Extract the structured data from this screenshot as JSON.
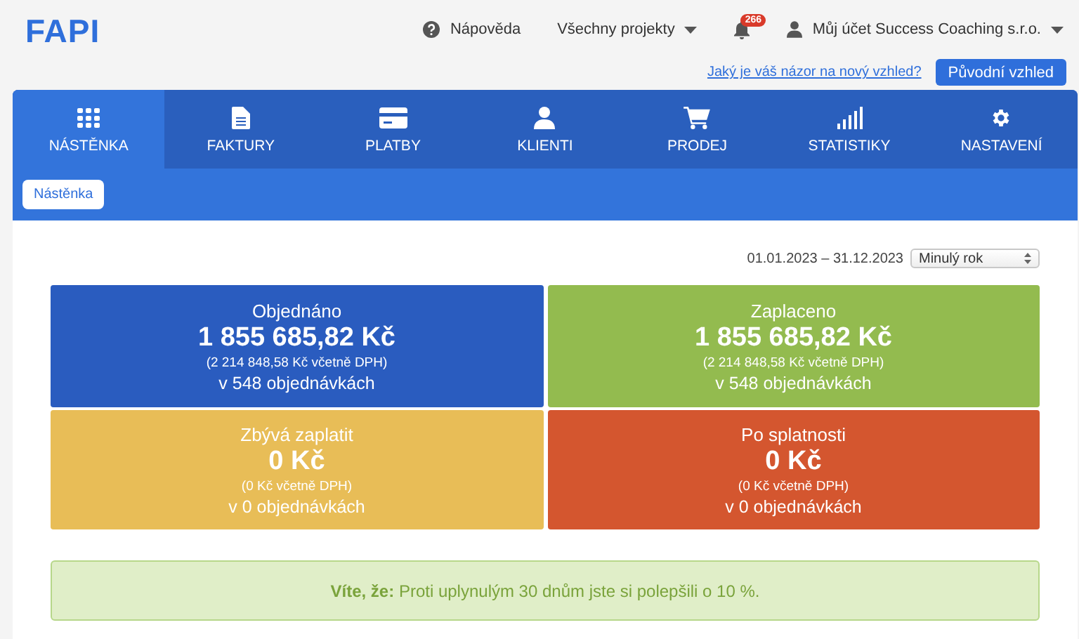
{
  "logo": "FAPI",
  "header": {
    "help": "Nápověda",
    "projects": "Všechny projekty",
    "notifications": "266",
    "account": "Můj účet Success Coaching s.r.o.",
    "feedback_link": "Jaký je váš názor na nový vzhled?",
    "old_look_button": "Původní vzhled"
  },
  "tabs": [
    {
      "label": "NÁSTĚNKA",
      "selected": true
    },
    {
      "label": "FAKTURY",
      "selected": false
    },
    {
      "label": "PLATBY",
      "selected": false
    },
    {
      "label": "KLIENTI",
      "selected": false
    },
    {
      "label": "PRODEJ",
      "selected": false
    },
    {
      "label": "STATISTIKY",
      "selected": false
    },
    {
      "label": "NASTAVENÍ",
      "selected": false
    }
  ],
  "breadcrumb": "Nástěnka",
  "date_range": "01.01.2023 – 31.12.2023",
  "period_select": "Minulý rok",
  "cards": [
    {
      "title": "Objednáno",
      "amount": "1 855 685,82 Kč",
      "vat_note": "(2 214 848,58 Kč včetně DPH)",
      "orders": "v 548 objednávkách",
      "color": "#2a5cbf"
    },
    {
      "title": "Zaplaceno",
      "amount": "1 855 685,82 Kč",
      "vat_note": "(2 214 848,58 Kč včetně DPH)",
      "orders": "v 548 objednávkách",
      "color": "#93bb4f"
    },
    {
      "title": "Zbývá zaplatit",
      "amount": "0 Kč",
      "vat_note": "(0 Kč včetně DPH)",
      "orders": "v 0 objednávkách",
      "color": "#e8bd57"
    },
    {
      "title": "Po splatnosti",
      "amount": "0 Kč",
      "vat_note": "(0 Kč včetně DPH)",
      "orders": "v 0 objednávkách",
      "color": "#d4562f"
    }
  ],
  "tip": "**Víte, že:** Proti uplynulým 30 dnům jste si polepšili o 10 %."
}
